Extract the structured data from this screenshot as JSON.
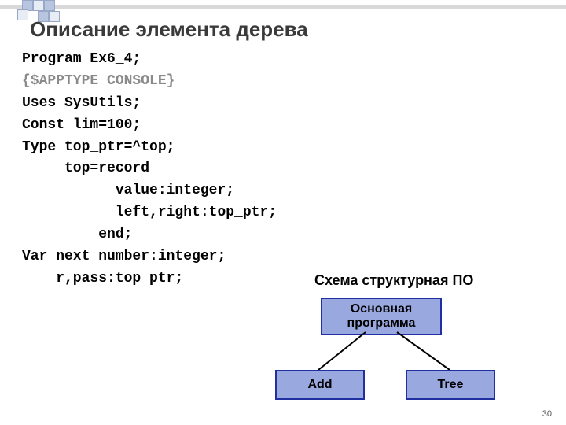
{
  "title": "Описание элемента дерева",
  "code": {
    "l1": "Program Ex6_4;",
    "l2": "{$APPTYPE CONSOLE}",
    "l3": "Uses SysUtils;",
    "l4": "Const lim=100;",
    "l5": "Type top_ptr=^top;",
    "l6": "     top=record",
    "l7": "           value:integer;",
    "l8": "           left,right:top_ptr;",
    "l9": "         end;",
    "l10": "Var next_number:integer;",
    "l11": "    r,pass:top_ptr;"
  },
  "diagram": {
    "title": "Схема структурная ПО",
    "root": "Основная программа",
    "left": "Add",
    "right": "Tree"
  },
  "page": "30"
}
